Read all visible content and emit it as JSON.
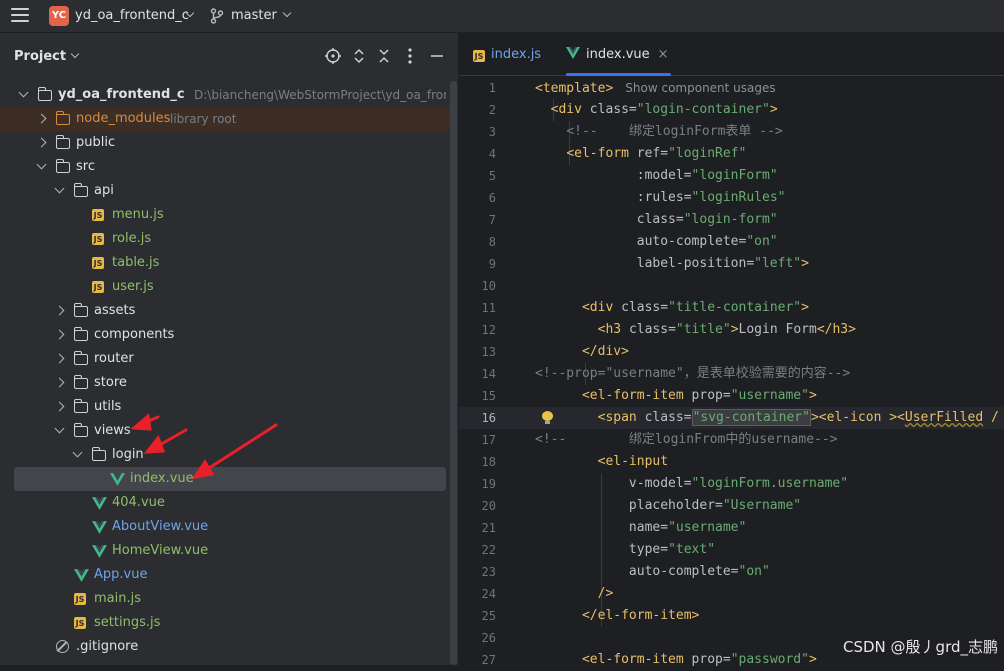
{
  "topbar": {
    "project_badge": "YC",
    "project_name": "yd_oa_frontend_c",
    "branch": "master"
  },
  "panel": {
    "title": "Project",
    "icons": [
      "crosshair-icon",
      "expand-collapse-icon",
      "collapse-all-icon",
      "options-icon",
      "minimize-icon"
    ]
  },
  "tree": [
    {
      "label": "yd_oa_frontend_c",
      "hint": "D:\\biancheng\\WebStormProject\\yd_oa_frontend_c",
      "type": "root",
      "depth": 0,
      "expanded": true
    },
    {
      "label": "node_modules",
      "hint": "library root",
      "type": "folder-excluded",
      "depth": 1,
      "expanded": false
    },
    {
      "label": "public",
      "type": "folder",
      "depth": 1,
      "expanded": false
    },
    {
      "label": "src",
      "type": "folder",
      "depth": 1,
      "expanded": true
    },
    {
      "label": "api",
      "type": "folder",
      "depth": 2,
      "expanded": true
    },
    {
      "label": "menu.js",
      "type": "js",
      "depth": 3
    },
    {
      "label": "role.js",
      "type": "js",
      "depth": 3
    },
    {
      "label": "table.js",
      "type": "js",
      "depth": 3
    },
    {
      "label": "user.js",
      "type": "js",
      "depth": 3
    },
    {
      "label": "assets",
      "type": "folder",
      "depth": 2,
      "expanded": false
    },
    {
      "label": "components",
      "type": "folder",
      "depth": 2,
      "expanded": false
    },
    {
      "label": "router",
      "type": "folder",
      "depth": 2,
      "expanded": false
    },
    {
      "label": "store",
      "type": "folder",
      "depth": 2,
      "expanded": false
    },
    {
      "label": "utils",
      "type": "folder",
      "depth": 2,
      "expanded": false
    },
    {
      "label": "views",
      "type": "folder",
      "depth": 2,
      "expanded": true
    },
    {
      "label": "login",
      "type": "folder",
      "depth": 3,
      "expanded": true
    },
    {
      "label": "index.vue",
      "type": "vue",
      "depth": 4,
      "selected": true
    },
    {
      "label": "404.vue",
      "type": "vue",
      "depth": 3
    },
    {
      "label": "AboutView.vue",
      "type": "vue-blue",
      "depth": 3
    },
    {
      "label": "HomeView.vue",
      "type": "vue",
      "depth": 3
    },
    {
      "label": "App.vue",
      "type": "vue-blue",
      "depth": 2
    },
    {
      "label": "main.js",
      "type": "js",
      "depth": 2
    },
    {
      "label": "settings.js",
      "type": "js",
      "depth": 2
    },
    {
      "label": ".gitignore",
      "type": "git",
      "depth": 1
    }
  ],
  "tabs": [
    {
      "label": "index.js",
      "type": "js",
      "active": false
    },
    {
      "label": "index.vue",
      "type": "vue",
      "active": true,
      "close": "×"
    }
  ],
  "code": {
    "usage_hint": "Show component usages",
    "current_line": 16,
    "lines": [
      {
        "n": "1"
      },
      {
        "n": "2"
      },
      {
        "n": "3"
      },
      {
        "n": "4"
      },
      {
        "n": "5"
      },
      {
        "n": "6"
      },
      {
        "n": "7"
      },
      {
        "n": "8"
      },
      {
        "n": "9"
      },
      {
        "n": "10"
      },
      {
        "n": "11"
      },
      {
        "n": "12"
      },
      {
        "n": "13"
      },
      {
        "n": "14"
      },
      {
        "n": "15"
      },
      {
        "n": "16"
      },
      {
        "n": "17"
      },
      {
        "n": "18"
      },
      {
        "n": "19"
      },
      {
        "n": "20"
      },
      {
        "n": "21"
      },
      {
        "n": "22"
      },
      {
        "n": "23"
      },
      {
        "n": "24"
      },
      {
        "n": "25"
      },
      {
        "n": "26"
      },
      {
        "n": "27"
      }
    ]
  },
  "watermark": "CSDN @殷丿grd_志鹏"
}
